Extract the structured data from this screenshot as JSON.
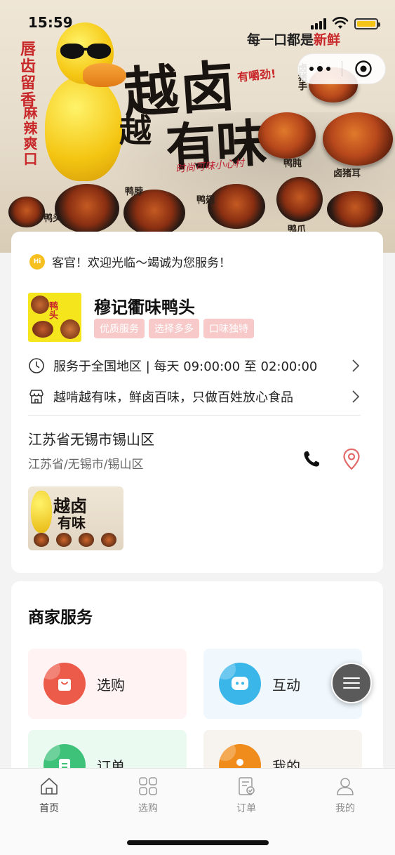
{
  "status_bar": {
    "time": "15:59"
  },
  "banner": {
    "title_line1": "越卤",
    "title_line2_prefix": "越",
    "title_line2": "有味",
    "slogan_prefix": "每一口都是",
    "slogan_highlight": "新鲜",
    "side_text_1": "唇齿留香",
    "side_text_2": "麻辣爽口",
    "tagline": "有嚼劲!",
    "signature": "时尚可味小心村",
    "food_labels": [
      "鸭头",
      "鸭脖",
      "鸭翅",
      "鸭爪",
      "鸭肫",
      "卤猪耳",
      "卤猪手"
    ]
  },
  "store": {
    "welcome": "客官！欢迎光临～竭诚为您服务！",
    "hi_badge": "Hi",
    "name": "穆记衢味鸭头",
    "logo_text": "鸭头",
    "tags": [
      "优质服务",
      "选择多多",
      "口味独特"
    ],
    "service_hours": "服务于全国地区 | 每天 09:00:00 至 02:00:00",
    "description": "越啃越有味，鲜卤百味，只做百姓放心食品",
    "address_main": "江苏省无锡市锡山区",
    "address_sub": "江苏省/无锡市/锡山区",
    "thumb_title1": "越卤",
    "thumb_title2": "有味"
  },
  "services": {
    "title": "商家服务",
    "items": [
      {
        "label": "选购",
        "color": "#ec5a4a",
        "icon": "shopping-bag-icon"
      },
      {
        "label": "互动",
        "color": "#3bb6e8",
        "icon": "chat-bubble-icon"
      },
      {
        "label": "订单",
        "color": "#3ec27a",
        "icon": "order-list-icon"
      },
      {
        "label": "我的",
        "color": "#f08c1c",
        "icon": "user-icon"
      }
    ]
  },
  "tabbar": {
    "items": [
      {
        "label": "首页",
        "icon": "home-icon",
        "active": true
      },
      {
        "label": "选购",
        "icon": "grid-icon",
        "active": false
      },
      {
        "label": "订单",
        "icon": "order-icon",
        "active": false
      },
      {
        "label": "我的",
        "icon": "profile-icon",
        "active": false
      }
    ]
  }
}
